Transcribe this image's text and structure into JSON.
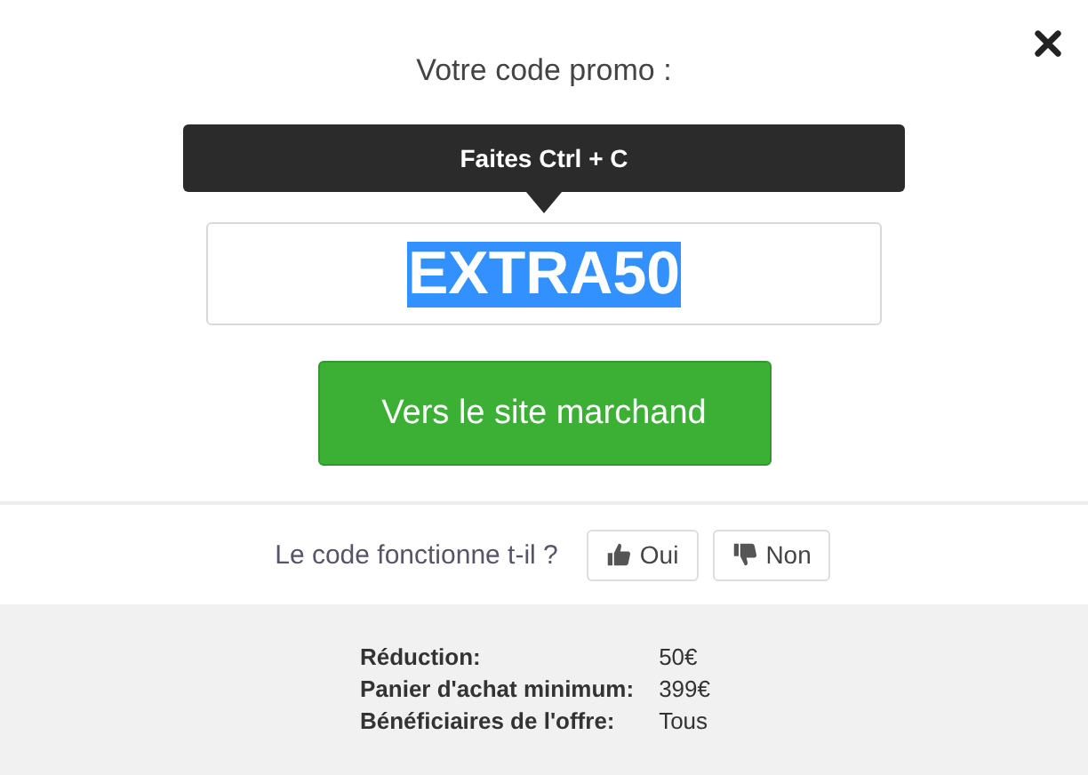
{
  "title": "Votre code promo :",
  "tooltip": "Faites Ctrl + C",
  "code": {
    "value": "EXTRA50",
    "highlighted": true
  },
  "cta": "Vers le site marchand",
  "feedback": {
    "question": "Le code fonctionne t-il ?",
    "buttons": [
      {
        "kind": "up",
        "label": "Oui"
      },
      {
        "kind": "down",
        "label": "Non"
      }
    ]
  },
  "details": [
    {
      "label": "Réduction:",
      "value": "50€"
    },
    {
      "label": "Panier d'achat minimum:",
      "value": "399€"
    },
    {
      "label": "Bénéficiaires de l'offre:",
      "value": "Tous"
    }
  ]
}
